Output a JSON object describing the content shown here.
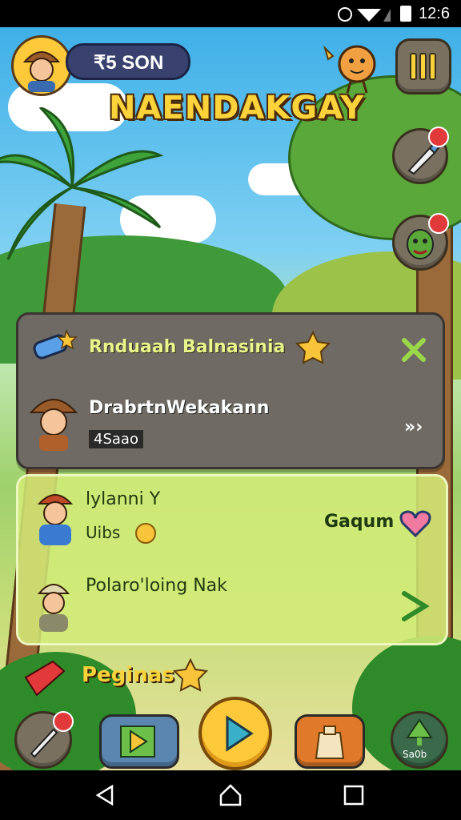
{
  "status_bar": {
    "time": "12:6"
  },
  "header": {
    "coins": "₹5 SON",
    "title": "NAENDAKGAY"
  },
  "panel_top": {
    "row1_label": "Rnduaah Balnasinia",
    "row2_name": "DrabrtnWekakann",
    "row2_value": "4Saao",
    "colors": {
      "accent": "#e7f58a"
    }
  },
  "panel_bottom": {
    "row1_name": "lylanni Y",
    "row1_sub": "Uibs",
    "row1_action": "Gaqum",
    "row2_label": "Polaro'loing Nak"
  },
  "footer_section": {
    "label": "Peginas"
  },
  "bottom_bar": {
    "right_label": "Sa0b"
  },
  "icons": [
    "pause-icon",
    "brush-icon",
    "monster-icon",
    "rocket-icon",
    "close-icon",
    "chevrons-icon",
    "heart-icon",
    "arrow-right-icon",
    "play-icon",
    "bag-icon",
    "tree-icon",
    "back-icon",
    "home-icon",
    "recent-icon"
  ]
}
